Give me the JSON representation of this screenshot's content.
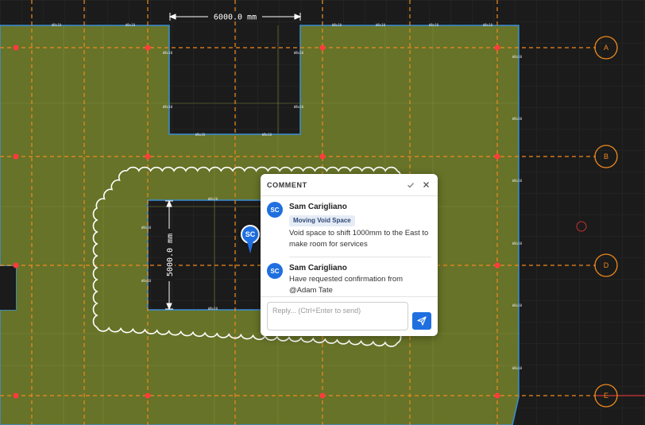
{
  "drawing": {
    "dimension_horizontal": "6000.0 mm",
    "dimension_vertical": "5000.0 mm",
    "member_tag": "W8x10",
    "grid_labels": [
      "A",
      "B",
      "D",
      "E"
    ]
  },
  "pin": {
    "initials": "SC"
  },
  "comment_panel": {
    "title": "COMMENT",
    "resolve_icon": "check-icon",
    "close_icon": "close-icon",
    "entries": [
      {
        "initials": "SC",
        "author": "Sam Carigliano",
        "tag": "Moving Void Space",
        "text": "Void space to shift 1000mm to the East to make room for services"
      },
      {
        "initials": "SC",
        "author": "Sam Carigliano",
        "text": "Have requested confirmation from @Adam Tate"
      }
    ],
    "reply_placeholder": "Reply... (Ctrl+Enter to send)",
    "send_icon": "send-icon"
  },
  "colors": {
    "slab": "#667328",
    "slab_edge": "#3b8fd8",
    "grid_line": "#f08a1e",
    "grid_node": "#ff3b3b",
    "background": "#1b1b1b",
    "accent": "#1f6fe0",
    "revision_cloud": "#ffffff"
  }
}
